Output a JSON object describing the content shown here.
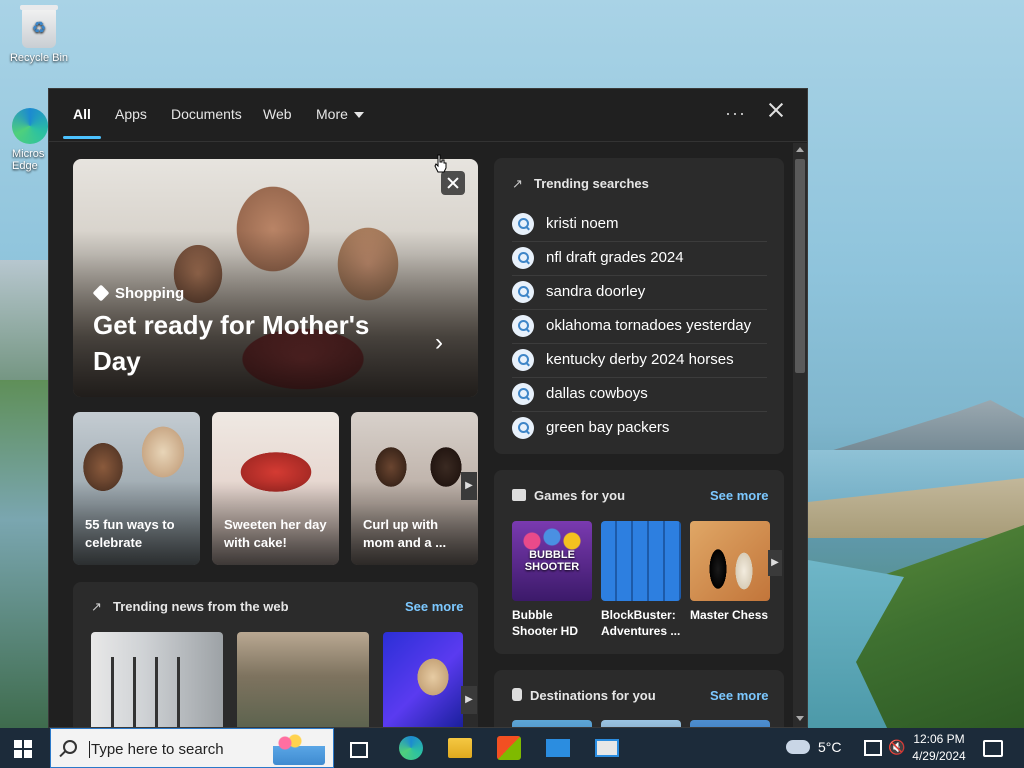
{
  "desktop": {
    "recycle_bin_label": "Recycle Bin",
    "edge_label": "Micros\nEdge"
  },
  "search_panel": {
    "tabs": [
      "All",
      "Apps",
      "Documents",
      "Web",
      "More"
    ],
    "active_tab": "All",
    "more_icon": "ellipsis-icon",
    "hero": {
      "tag": "Shopping",
      "title": "Get ready for Mother's Day"
    },
    "cards": [
      {
        "label": "55 fun ways to celebrate"
      },
      {
        "label": "Sweeten her day with cake!"
      },
      {
        "label": "Curl up with mom and a ..."
      }
    ],
    "trending_news": {
      "title": "Trending news from the web",
      "see_more": "See more"
    },
    "trending_searches": {
      "title": "Trending searches",
      "items": [
        "kristi noem",
        "nfl draft grades 2024",
        "sandra doorley",
        "oklahoma tornadoes yesterday",
        "kentucky derby 2024 horses",
        "dallas cowboys",
        "green bay packers"
      ]
    },
    "games": {
      "title": "Games for you",
      "see_more": "See more",
      "items": [
        {
          "name": "Bubble Shooter HD",
          "art_text": "BUBBLE SHOOTER"
        },
        {
          "name": "BlockBuster: Adventures ..."
        },
        {
          "name": "Master Chess"
        }
      ]
    },
    "destinations": {
      "title": "Destinations for you",
      "see_more": "See more"
    }
  },
  "taskbar": {
    "search_placeholder": "Type here to search",
    "weather_temp": "5°C",
    "time": "12:06 PM",
    "date": "4/29/2024"
  },
  "colors": {
    "accent": "#4cc2ff",
    "link": "#7cc8ff",
    "panel_bg": "#202020",
    "card_bg": "#2b2b2b"
  }
}
